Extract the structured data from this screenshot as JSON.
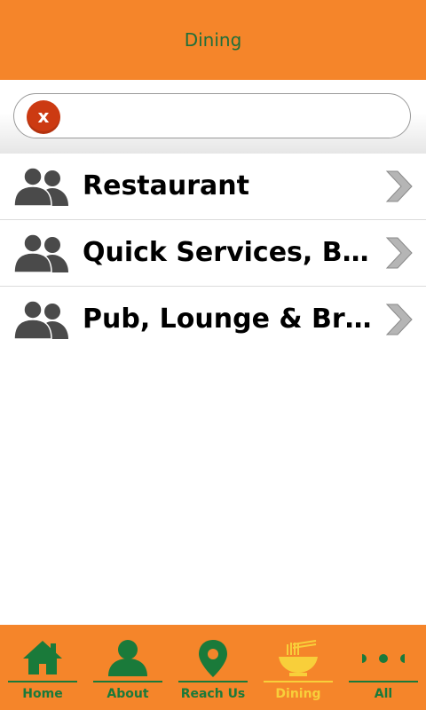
{
  "header": {
    "title": "Dining"
  },
  "search": {
    "value": "",
    "clear_label": "x"
  },
  "list": {
    "items": [
      {
        "label": "Restaurant",
        "icon": "group-icon"
      },
      {
        "label": "Quick Services, Bakery & Café",
        "icon": "group-icon"
      },
      {
        "label": "Pub, Lounge & Brewery",
        "icon": "group-icon"
      }
    ]
  },
  "tabbar": {
    "tabs": [
      {
        "label": "Home",
        "icon": "home-icon",
        "active": false
      },
      {
        "label": "About",
        "icon": "person-icon",
        "active": false
      },
      {
        "label": "Reach Us",
        "icon": "map-pin-icon",
        "active": false
      },
      {
        "label": "Dining",
        "icon": "noodle-bowl-icon",
        "active": true
      },
      {
        "label": "All",
        "icon": "more-dots-icon",
        "active": false
      }
    ]
  },
  "colors": {
    "brand": "#f5852a",
    "title_green": "#1f6f3a",
    "active_tab": "#f8cf3a",
    "clear_button": "#cc3a12",
    "icon_gray": "#4a4a4a"
  }
}
